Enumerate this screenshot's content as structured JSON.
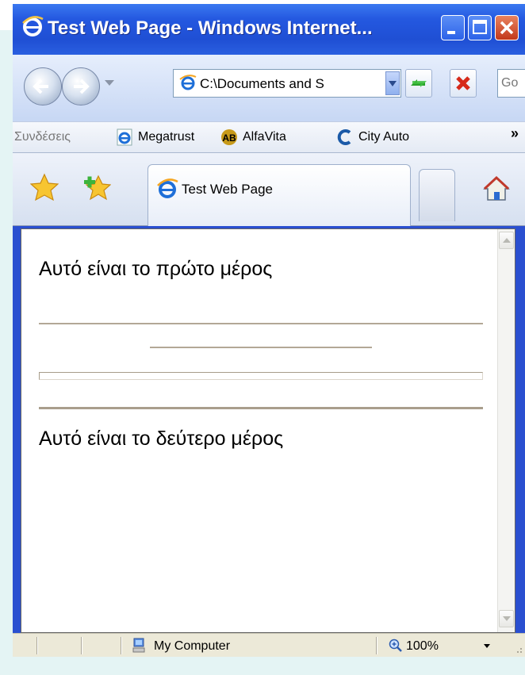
{
  "window": {
    "title": "Test Web Page - Windows Internet...",
    "icon": "ie-logo-icon",
    "controls": [
      "minimize-icon",
      "maximize-icon",
      "close-icon"
    ]
  },
  "address_bar": {
    "url": "C:\\Documents and S",
    "search_placeholder": "Go"
  },
  "links_bar": {
    "label": "Συνδέσεις",
    "links": [
      {
        "label": "Megatrust",
        "icon": "ie-page-icon"
      },
      {
        "label": "AlfaVita",
        "icon": "ab-logo-icon"
      },
      {
        "label": "City Auto",
        "icon": "c-logo-icon"
      }
    ],
    "overflow": "»"
  },
  "tabs": [
    {
      "label": "Test Web Page",
      "icon": "ie-logo-icon",
      "active": true
    }
  ],
  "content": {
    "paragraph1": "Αυτό είναι το πρώτο μέρος",
    "paragraph2": "Αυτό είναι το δεύτερο μέρος"
  },
  "status_bar": {
    "zone": "My Computer",
    "zoom": "100%"
  },
  "colors": {
    "title_bar": "#2458e0",
    "close_button": "#c2381b",
    "hr": "#b3a896"
  }
}
